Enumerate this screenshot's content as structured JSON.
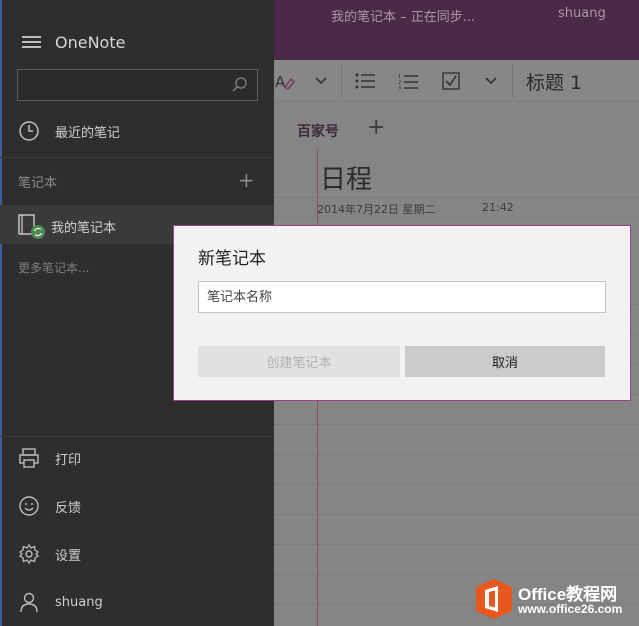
{
  "app": {
    "name": "OneNote",
    "window_title": "我的笔记本 – 正在同步...",
    "user": "shuang"
  },
  "ribbon": {
    "heading_style": "标题 1"
  },
  "section": {
    "active_tab": "百家号",
    "add_symbol": "+"
  },
  "page": {
    "title": "日程",
    "date": "2014年7月22日  星期二",
    "time": "21:42"
  },
  "nav": {
    "search_placeholder": "",
    "recent_label": "最近的笔记",
    "notebooks_label": "笔记本",
    "add_symbol": "+",
    "notebook_name": "我的笔记本",
    "more_notebooks": "更多笔记本...",
    "bottom": [
      {
        "label": "打印",
        "icon": "printer-icon"
      },
      {
        "label": "反馈",
        "icon": "smiley-icon"
      },
      {
        "label": "设置",
        "icon": "gear-icon"
      },
      {
        "label": "shuang",
        "icon": "person-icon"
      }
    ]
  },
  "dialog": {
    "title": "新笔记本",
    "input_placeholder": "笔记本名称",
    "input_value": "",
    "create_label": "创建笔记本",
    "cancel_label": "取消"
  },
  "watermark": {
    "brand": "Office教程网",
    "url": "www.office26.com",
    "colors": {
      "orange": "#e8571d"
    }
  }
}
